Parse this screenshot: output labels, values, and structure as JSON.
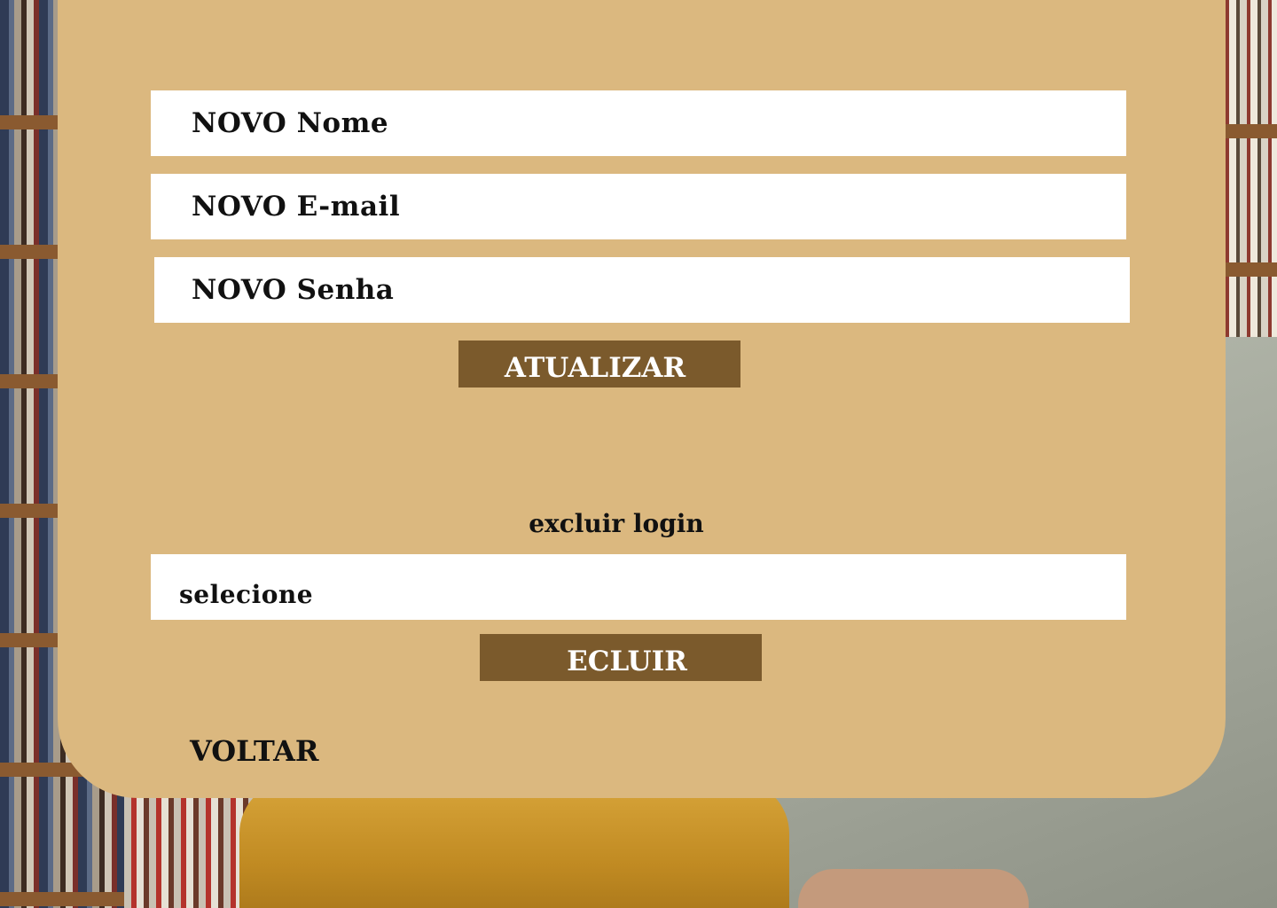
{
  "form": {
    "name_placeholder": "NOVO Nome",
    "email_placeholder": "NOVO E-mail",
    "password_placeholder": "NOVO Senha",
    "update_button": "ATUALIZAR"
  },
  "delete_section": {
    "title": "excluir login",
    "select_value": "selecione",
    "delete_button": "ECLUIR"
  },
  "navigation": {
    "back_link": "VOLTAR"
  },
  "colors": {
    "panel": "#dbb87f",
    "button": "#7b5a2c",
    "field": "#ffffff",
    "text": "#111111"
  }
}
